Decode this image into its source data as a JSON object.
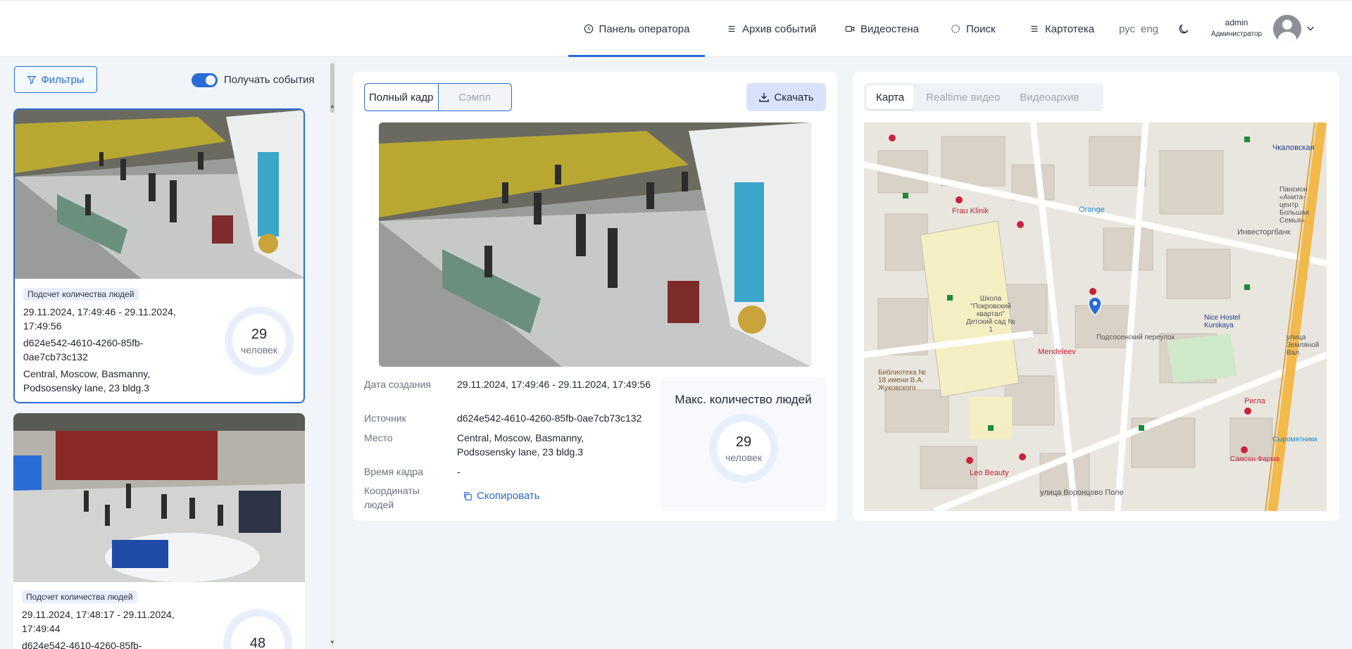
{
  "header": {
    "nav": [
      {
        "label": "Панель оператора",
        "active": true
      },
      {
        "label": "Архив событий"
      },
      {
        "label": "Видеостена"
      },
      {
        "label": "Поиск"
      },
      {
        "label": "Картотека"
      }
    ],
    "lang_ru": "рус",
    "lang_en": "eng",
    "user_name": "admin",
    "user_role": "Администратор"
  },
  "left": {
    "filters_label": "Фильтры",
    "toggle_label": "Получать события",
    "toggle_on": true,
    "cards": [
      {
        "tag": "Подсчет количества людей",
        "datetime": "29.11.2024, 17:49:46 - 29.11.2024, 17:49:56",
        "source": "d624e542-4610-4260-85fb-0ae7cb73c132",
        "place": "Central, Moscow, Basmanny, Podsosensky lane, 23 bldg.3",
        "count": "29",
        "unit": "человек"
      },
      {
        "tag": "Подсчет количества людей",
        "datetime": "29.11.2024, 17:48:17 - 29.11.2024, 17:49:44",
        "source": "d624e542-4610-4260-85fb-",
        "count": "48"
      }
    ]
  },
  "center": {
    "seg_full": "Полный кадр",
    "seg_sample": "Сэмпл",
    "download": "Скачать",
    "labels": {
      "created": "Дата создания",
      "source": "Источник",
      "place": "Место",
      "frame_time": "Время кадра",
      "coords": "Координаты людей"
    },
    "values": {
      "created": "29.11.2024, 17:49:46 - 29.11.2024, 17:49:56",
      "source": "d624e542-4610-4260-85fb-0ae7cb73c132",
      "place": "Central, Moscow, Basmanny, Podsosensky lane, 23 bldg.3",
      "frame_time": "-"
    },
    "copy": "Скопировать",
    "max_title": "Макс. количество людей",
    "max_count": "29",
    "max_unit": "человек"
  },
  "right": {
    "tabs": [
      "Карта",
      "Realtime видео",
      "Видеоархив"
    ],
    "map_labels": [
      "Чкаловская",
      "Пансион «Анита-центр Большая Семья»",
      "Frau Klinik",
      "Orange",
      "Инвесторгбанк",
      "Школа \"Покровский квартал\" Детский сад № 1",
      "Подсосенский переулок",
      "Nice Hostel Kurskaya",
      "Mendeleev",
      "Библиотека № 18 имени В.А. Жуковского",
      "улица Воронцово Поле",
      "Leo Beauty",
      "Ригла",
      "улица Земляной Вал",
      "Сыромятники",
      "Самсон Фарма"
    ]
  },
  "colors": {
    "accent": "#2a6cd6",
    "bg": "#f1f4f9"
  }
}
